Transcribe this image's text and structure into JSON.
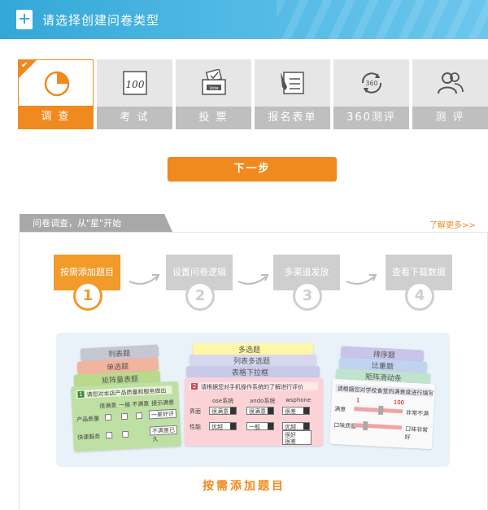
{
  "header": {
    "title": "请选择创建问卷类型"
  },
  "types": [
    {
      "label": "调 查",
      "icon": "pie-chart-icon",
      "active": true
    },
    {
      "label": "考 试",
      "icon": "score-sheet-icon",
      "active": false
    },
    {
      "label": "投 票",
      "icon": "vote-box-icon",
      "active": false
    },
    {
      "label": "报名表单",
      "icon": "form-pen-icon",
      "active": false
    },
    {
      "label": "360测评",
      "icon": "refresh-360-icon",
      "active": false
    },
    {
      "label": "测 评",
      "icon": "users-icon",
      "active": false
    }
  ],
  "vote_box_text": "Vote",
  "eval_icon_text": "360",
  "next_button": "下一步",
  "panel": {
    "tab": "问卷调查，从\"星\"开始",
    "more_link": "了解更多>>",
    "steps": [
      {
        "label": "按需添加题目",
        "num": "1"
      },
      {
        "label": "设置问卷逻辑",
        "num": "2"
      },
      {
        "label": "多渠道发放",
        "num": "3"
      },
      {
        "label": "查看下载数据",
        "num": "4"
      }
    ],
    "caption": "按需添加题目"
  },
  "illustration": {
    "left_cards": [
      "列表题",
      "单选题",
      "矩阵量表题"
    ],
    "left_question": "请您对本店产品质量和服务做出",
    "left_cols": [
      "很满意",
      "一般",
      "不满意",
      "提示满意"
    ],
    "left_rows": [
      "产品质量",
      "快速服务"
    ],
    "left_inputs": [
      "一星好评",
      "不满意已久"
    ],
    "mid_cards": [
      "多选题",
      "列表多选题",
      "表格下拉框"
    ],
    "mid_question": "请根据您对手机操作系统的了解进行评价",
    "mid_cols": [
      "ose系统",
      "ando系统",
      "wsphone"
    ],
    "mid_rows": [
      "界面",
      "性能"
    ],
    "mid_selects": [
      "很满意",
      "很满意",
      "很差",
      "优越",
      "一般",
      "优越"
    ],
    "mid_drop_options": [
      "很好",
      "很差"
    ],
    "right_cards": [
      "排序题",
      "比重题",
      "矩阵滑动条"
    ],
    "right_question": "请根据您对学校食堂的满意度进行填写",
    "right_rows": [
      "满意",
      "口味质量"
    ],
    "right_scale": [
      "1",
      "100"
    ],
    "right_ends": [
      "非常不满",
      "口味非常好"
    ]
  },
  "colors": {
    "accent": "#f08a1e",
    "header": "#3ba9dc",
    "inactive": "#bfbfbf"
  }
}
